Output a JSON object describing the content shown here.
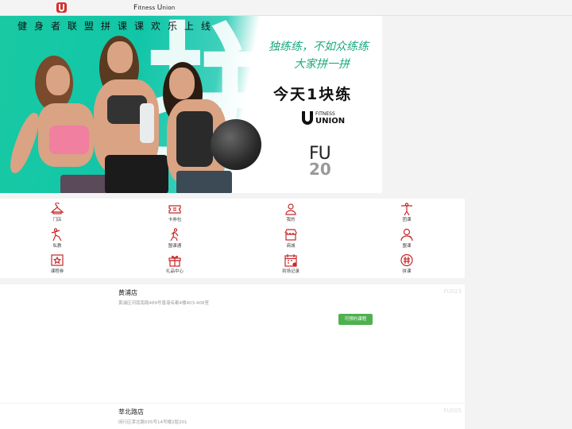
{
  "header": {
    "brand_first_f": "F",
    "brand_rest_1": "itness ",
    "brand_first_u": "U",
    "brand_rest_2": "nion"
  },
  "banner": {
    "slogan": "健身者联盟拼课课欢乐上线",
    "watermark": "拼",
    "calligraphy_line1": "独练练，不如众练练",
    "calligraphy_line2": "大家拼一拼",
    "price_line": "今天1块练",
    "logo_fitness": "FITNESS",
    "logo_union": "UNION",
    "badge_line1": "FU",
    "badge_line2": "20",
    "colors": {
      "teal": "#19c9a3",
      "calligraphy": "#1aa97e"
    }
  },
  "menu": {
    "items": [
      {
        "label": "门店",
        "icon": "hanger-icon"
      },
      {
        "label": "卡券包",
        "icon": "ticket-icon"
      },
      {
        "label": "我的",
        "icon": "user-icon"
      },
      {
        "label": "团课",
        "icon": "group-class-icon"
      },
      {
        "label": "私教",
        "icon": "personal-trainer-icon"
      },
      {
        "label": "盟课通",
        "icon": "running-person-icon"
      },
      {
        "label": "商城",
        "icon": "shop-icon"
      },
      {
        "label": "盟课",
        "icon": "coach-icon"
      },
      {
        "label": "课程券",
        "icon": "course-coupon-icon"
      },
      {
        "label": "礼品中心",
        "icon": "gift-icon"
      },
      {
        "label": "到场记录",
        "icon": "calendar-icon"
      },
      {
        "label": "拼课",
        "icon": "hash-icon"
      }
    ],
    "icon_color": "#c62828"
  },
  "stores": [
    {
      "name": "黄浦店",
      "address": "黄浦区河南南路489号香港名都4楼403-406室",
      "code": "FU023",
      "button": "可预约课程"
    },
    {
      "name": "莘北路店",
      "address": "闵行区莘北路505号14号楼2层201",
      "code": "FU005"
    }
  ],
  "button_color": "#4fb050"
}
